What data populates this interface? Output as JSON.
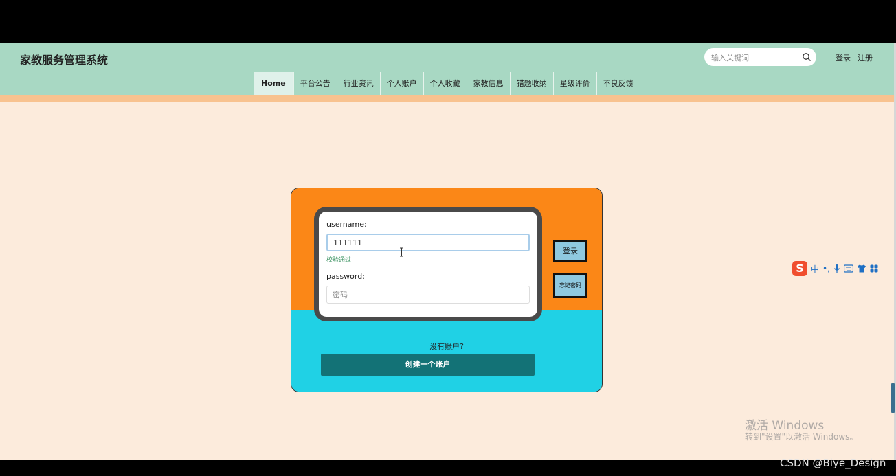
{
  "header": {
    "site_title": "家教服务管理系统",
    "search_placeholder": "输入关键词",
    "login_link": "登录",
    "register_link": "注册"
  },
  "nav": {
    "items": [
      "Home",
      "平台公告",
      "行业资讯",
      "个人账户",
      "个人收藏",
      "家教信息",
      "错题收纳",
      "星级评价",
      "不良反馈"
    ]
  },
  "login_form": {
    "username_label": "username:",
    "username_value": "111111",
    "validation_message": "校验通过",
    "password_label": "password:",
    "password_placeholder": "密码",
    "login_button": "登录",
    "forgot_button": "忘记密码",
    "no_account_text": "没有账户?",
    "create_account_button": "创建一个账户"
  },
  "ime_toolbar": {
    "logo": "S",
    "mode": "中",
    "punct": "•,"
  },
  "watermark": {
    "title": "激活 Windows",
    "subtitle": "转到\"设置\"以激活 Windows。"
  },
  "credit": "CSDN @Biye_Design",
  "colors": {
    "header_bg": "#a8d8c3",
    "page_bg": "#fcebdc",
    "card_top": "#fb8717",
    "card_bottom": "#20d1e5",
    "create_button": "#137276",
    "side_button": "#8fc9e0"
  }
}
